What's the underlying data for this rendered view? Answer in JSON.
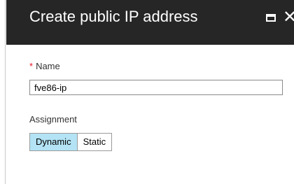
{
  "blade": {
    "title": "Create public IP address",
    "maximize_icon": "maximize-icon",
    "close_icon": "close-icon",
    "close_glyph": "✕"
  },
  "form": {
    "name": {
      "required_marker": "*",
      "label": "Name",
      "value": "fve86-ip"
    },
    "assignment": {
      "label": "Assignment",
      "options": [
        "Dynamic",
        "Static"
      ],
      "selected": "Dynamic"
    }
  },
  "colors": {
    "header_bg": "#262626",
    "required": "#e81123",
    "selected_option_bg": "#b3e3f4"
  }
}
